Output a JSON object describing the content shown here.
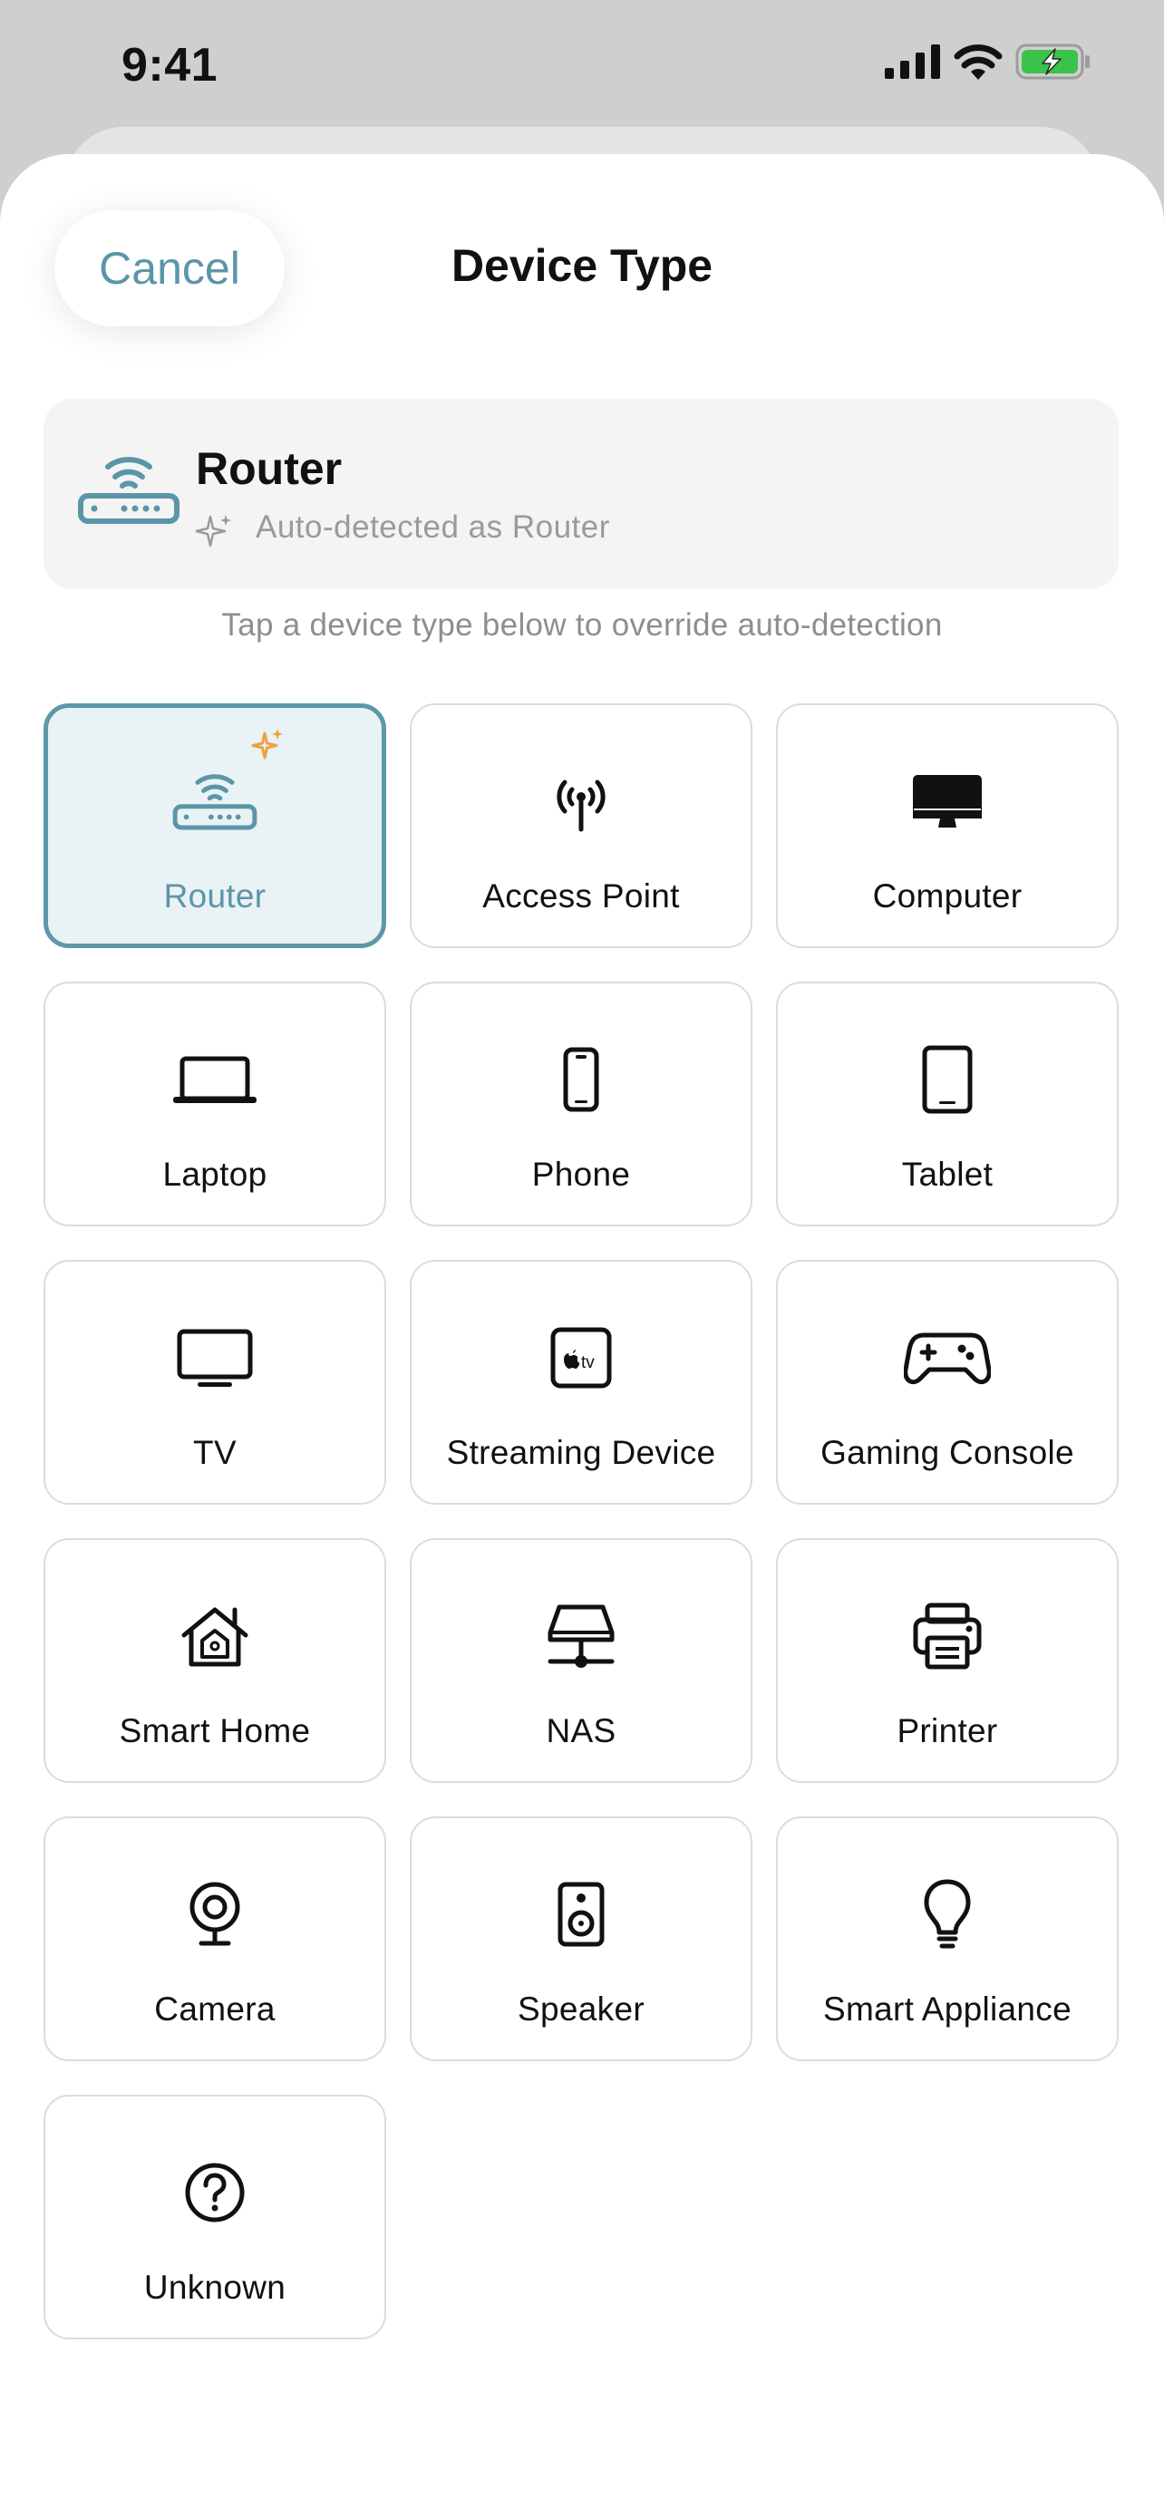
{
  "status_bar": {
    "time": "9:41"
  },
  "header": {
    "cancel_label": "Cancel",
    "title": "Device Type"
  },
  "detected": {
    "name": "Router",
    "subtitle": "Auto-detected as Router"
  },
  "hint": "Tap a device type below to override auto-detection",
  "device_types": [
    {
      "label": "Router",
      "icon": "router-icon",
      "selected": true
    },
    {
      "label": "Access Point",
      "icon": "access-point-icon"
    },
    {
      "label": "Computer",
      "icon": "desktop-computer-icon"
    },
    {
      "label": "Laptop",
      "icon": "laptop-icon"
    },
    {
      "label": "Phone",
      "icon": "phone-icon"
    },
    {
      "label": "Tablet",
      "icon": "tablet-icon"
    },
    {
      "label": "TV",
      "icon": "tv-icon"
    },
    {
      "label": "Streaming Device",
      "icon": "apple-tv-icon"
    },
    {
      "label": "Gaming Console",
      "icon": "gamepad-icon"
    },
    {
      "label": "Smart Home",
      "icon": "smart-home-icon"
    },
    {
      "label": "NAS",
      "icon": "nas-drive-icon"
    },
    {
      "label": "Printer",
      "icon": "printer-icon"
    },
    {
      "label": "Camera",
      "icon": "webcam-icon"
    },
    {
      "label": "Speaker",
      "icon": "speaker-icon"
    },
    {
      "label": "Smart Appliance",
      "icon": "lightbulb-icon"
    },
    {
      "label": "Unknown",
      "icon": "question-mark-icon"
    }
  ],
  "colors": {
    "accent": "#5b95a8",
    "selected_bg": "#e9f2f4",
    "sparkle": "#f0a040",
    "battery": "#3ac24a"
  }
}
